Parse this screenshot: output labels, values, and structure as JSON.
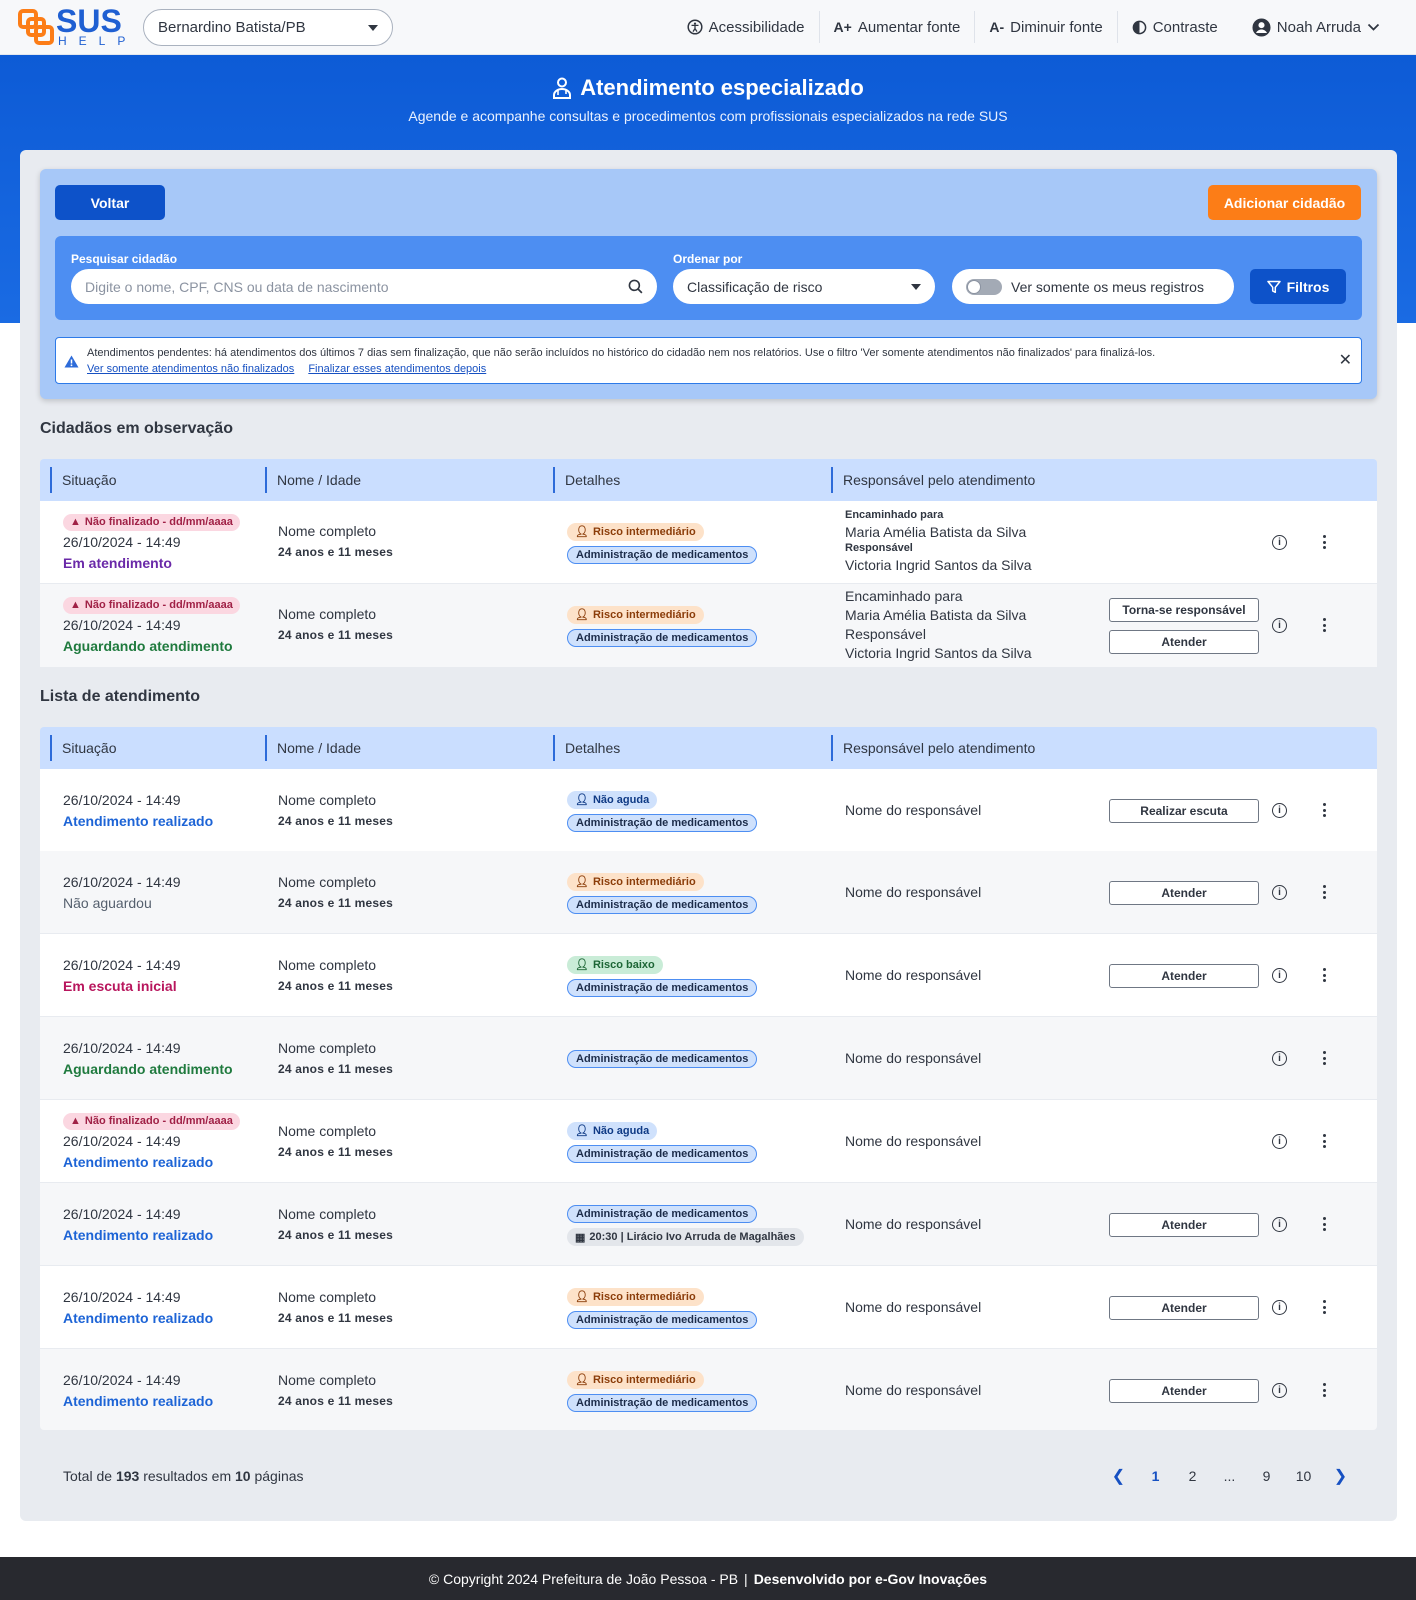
{
  "header": {
    "logo_main": "SUS",
    "logo_sub": "HELP",
    "city": "Bernardino Batista/PB",
    "accessibility": "Acessibilidade",
    "font_up_icon": "A+",
    "font_up": "Aumentar fonte",
    "font_down_icon": "A-",
    "font_down": "Diminuir fonte",
    "contrast": "Contraste",
    "user": "Noah Arruda"
  },
  "hero": {
    "title": "Atendimento especializado",
    "subtitle": "Agende e acompanhe consultas e procedimentos com profissionais especializados na rede SUS"
  },
  "toolbar": {
    "back": "Voltar",
    "add": "Adicionar cidadão",
    "search_label": "Pesquisar cidadão",
    "search_placeholder": "Digite o nome, CPF, CNS ou data de nascimento",
    "order_label": "Ordenar por",
    "order_value": "Classificação de risco",
    "toggle_label": "Ver somente os meus registros",
    "filters": "Filtros"
  },
  "alert": {
    "text": "Atendimentos pendentes: há atendimentos dos últimos 7 dias sem finalização, que não serão incluídos no histórico do cidadão nem nos relatórios. Use o filtro 'Ver somente atendimentos não finalizados' para finalizá-los.",
    "link1": "Ver somente atendimentos não finalizados",
    "link2": "Finalizar esses atendimentos depois"
  },
  "columns": {
    "status": "Situação",
    "name": "Nome / Idade",
    "details": "Detalhes",
    "responsible": "Responsável pelo atendimento"
  },
  "observation": {
    "title": "Cidadãos em observação",
    "rows": [
      {
        "warning": "Não finalizado - dd/mm/aaaa",
        "datetime": "26/10/2024 - 14:49",
        "status": "Em atendimento",
        "name": "Nome completo",
        "age": "24 anos e 11 meses",
        "risk": "Risco intermediário",
        "service": "Administração de medicamentos",
        "fwd_label": "Encaminhado para",
        "fwd_name": "Maria Amélia Batista da Silva",
        "resp_label": "Responsável",
        "resp_name": "Victoria Ingrid Santos da Silva"
      },
      {
        "warning": "Não finalizado - dd/mm/aaaa",
        "datetime": "26/10/2024 - 14:49",
        "status": "Aguardando atendimento",
        "name": "Nome completo",
        "age": "24 anos e 11 meses",
        "risk": "Risco intermediário",
        "service": "Administração de medicamentos",
        "fwd_label": "Encaminhado para",
        "fwd_name": "Maria Amélia Batista da Silva",
        "resp_label": "Responsável",
        "resp_name": "Victoria Ingrid Santos da Silva",
        "action1": "Torna-se responsável",
        "action2": "Atender"
      }
    ]
  },
  "list": {
    "title": "Lista de atendimento",
    "rows": [
      {
        "datetime": "26/10/2024 - 14:49",
        "status": "Atendimento realizado",
        "name": "Nome completo",
        "age": "24 anos e 11 meses",
        "risk": "Não aguda",
        "service": "Administração de medicamentos",
        "responsible": "Nome do responsável",
        "action": "Realizar escuta"
      },
      {
        "datetime": "26/10/2024 - 14:49",
        "status": "Não aguardou",
        "name": "Nome completo",
        "age": "24 anos e 11 meses",
        "risk": "Risco intermediário",
        "service": "Administração de medicamentos",
        "responsible": "Nome do responsável",
        "action": "Atender"
      },
      {
        "datetime": "26/10/2024 - 14:49",
        "status": "Em escuta inicial",
        "name": "Nome completo",
        "age": "24 anos e 11 meses",
        "risk": "Risco baixo",
        "service": "Administração de medicamentos",
        "responsible": "Nome do responsável",
        "action": "Atender"
      },
      {
        "datetime": "26/10/2024 - 14:49",
        "status": "Aguardando atendimento",
        "name": "Nome completo",
        "age": "24 anos e 11 meses",
        "service": "Administração de medicamentos",
        "responsible": "Nome do responsável"
      },
      {
        "warning": "Não finalizado - dd/mm/aaaa",
        "datetime": "26/10/2024 - 14:49",
        "status": "Atendimento realizado",
        "name": "Nome completo",
        "age": "24 anos e 11 meses",
        "risk": "Não aguda",
        "service": "Administração de medicamentos",
        "responsible": "Nome do responsável"
      },
      {
        "datetime": "26/10/2024 - 14:49",
        "status": "Atendimento realizado",
        "name": "Nome completo",
        "age": "24 anos e 11 meses",
        "service": "Administração de medicamentos",
        "schedule": "20:30 | Lirácio Ivo Arruda de Magalhães",
        "responsible": "Nome do responsável",
        "action": "Atender"
      },
      {
        "datetime": "26/10/2024 - 14:49",
        "status": "Atendimento realizado",
        "name": "Nome completo",
        "age": "24 anos e 11 meses",
        "risk": "Risco intermediário",
        "service": "Administração de medicamentos",
        "responsible": "Nome do responsável",
        "action": "Atender"
      },
      {
        "datetime": "26/10/2024 - 14:49",
        "status": "Atendimento realizado",
        "name": "Nome completo",
        "age": "24 anos e 11 meses",
        "risk": "Risco intermediário",
        "service": "Administração de medicamentos",
        "responsible": "Nome do responsável",
        "action": "Atender"
      }
    ]
  },
  "pagination": {
    "total_prefix": "Total de",
    "total": "193",
    "mid": "resultados em",
    "pages": "10",
    "suffix": "páginas",
    "items": [
      "1",
      "2",
      "...",
      "9",
      "10"
    ]
  },
  "footer": {
    "copyright": "© Copyright 2024 Prefeitura de João Pessoa - PB",
    "separator": "|",
    "developer": "Desenvolvido por e-Gov Inovações"
  },
  "colors": {
    "primary": "#0d52c9",
    "accent": "#fc7d17",
    "hero": "#0d5bd6"
  }
}
